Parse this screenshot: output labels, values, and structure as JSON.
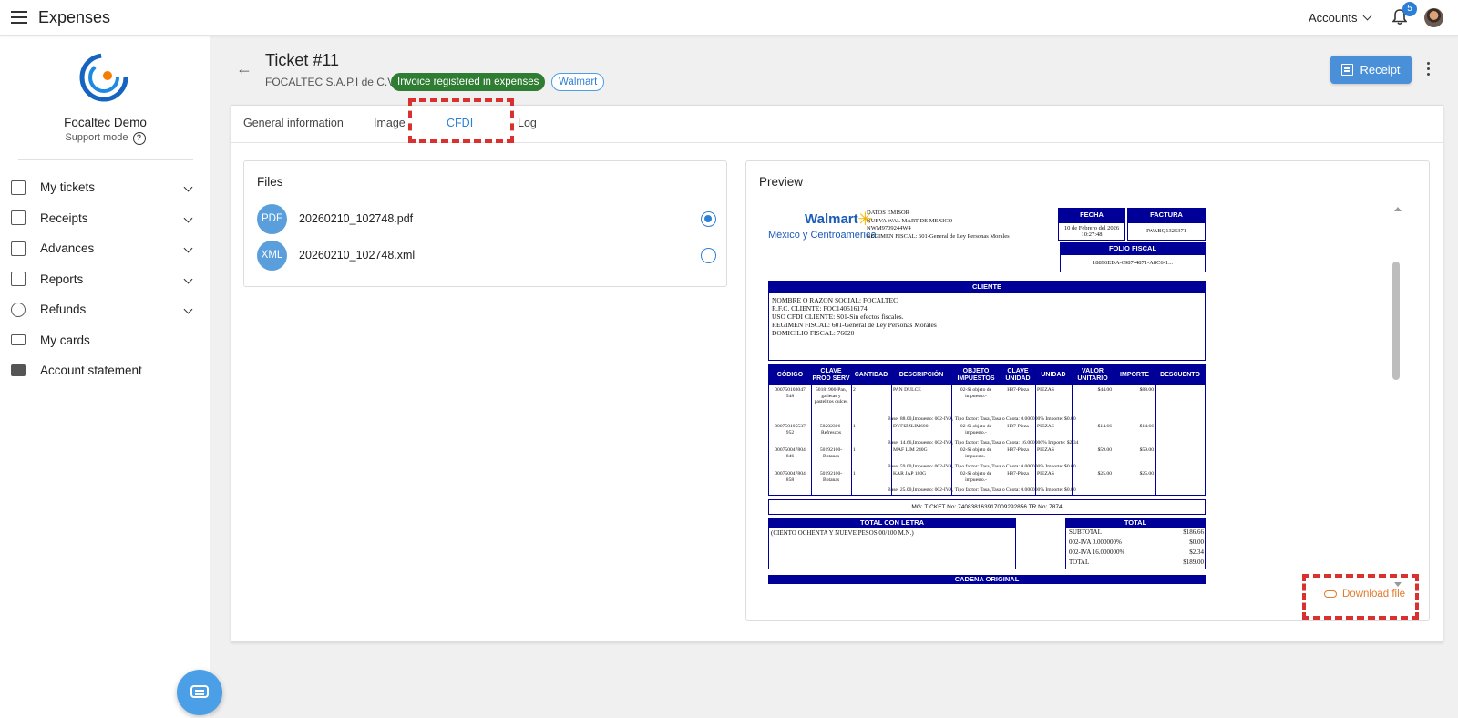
{
  "app": {
    "title": "Expenses"
  },
  "topbar": {
    "accounts_label": "Accounts",
    "notification_count": "5"
  },
  "sidebar": {
    "company": "Focaltec Demo",
    "mode": "Support mode",
    "help_icon": "?",
    "items": [
      {
        "label": "My tickets",
        "icon": "receipt-long-icon",
        "expandable": true
      },
      {
        "label": "Receipts",
        "icon": "document-list-icon",
        "expandable": true
      },
      {
        "label": "Advances",
        "icon": "cash-icon",
        "expandable": true
      },
      {
        "label": "Reports",
        "icon": "report-icon",
        "expandable": true
      },
      {
        "label": "Refunds",
        "icon": "refund-icon",
        "expandable": true
      },
      {
        "label": "My cards",
        "icon": "credit-card-icon",
        "expandable": false
      },
      {
        "label": "Account statement",
        "icon": "wallet-icon",
        "expandable": false
      }
    ]
  },
  "header": {
    "title": "Ticket #11",
    "company": "FOCALTEC S.A.P.I de C.V",
    "status_badge": "Invoice registered in expenses",
    "vendor_badge": "Walmart",
    "receipt_button": "Receipt"
  },
  "tabs": [
    {
      "label": "General information",
      "active": false
    },
    {
      "label": "Image",
      "active": false
    },
    {
      "label": "CFDI",
      "active": true
    },
    {
      "label": "Log",
      "active": false
    }
  ],
  "files": {
    "title": "Files",
    "items": [
      {
        "type": "PDF",
        "name": "20260210_102748.pdf",
        "selected": true
      },
      {
        "type": "XML",
        "name": "20260210_102748.xml",
        "selected": false
      }
    ]
  },
  "preview": {
    "title": "Preview",
    "download_label": "Download file"
  },
  "invoice": {
    "logo_text": "Walmart",
    "logo_sub": "México y Centroamérica",
    "emisor_lines": [
      "DATOS EMISOR",
      "NUEVA WAL MART DE MEXICO",
      "NWM9709244W4",
      "REGIMEN FISCAL: 601-General de Ley Personas Morales"
    ],
    "fecha_label": "FECHA",
    "fecha_value": "10 de Febrero del 2026 10:27:48",
    "factura_label": "FACTURA",
    "factura_value": "IWABQ1325371",
    "folio_label": "FOLIO FISCAL",
    "folio_value": "18896EDA-6987-4871-A8C6-1...",
    "cliente_label": "CLIENTE",
    "cliente_lines": [
      "NOMBRE O RAZON SOCIAL: FOCALTEC",
      "R.F.C. CLIENTE: FOC140516174",
      "USO CFDI CLIENTE: S01-Sin efectos fiscales.",
      "REGIMEN FISCAL: 601-General de Ley Personas Morales",
      "DOMICILIO FISCAL: 76020"
    ],
    "table_headers": [
      "CÓDIGO",
      "CLAVE PROD SERV",
      "CANTIDAD",
      "DESCRIPCIÓN",
      "OBJETO IMPUESTOS",
      "CLAVE UNIDAD",
      "UNIDAD",
      "VALOR UNITARIO",
      "IMPORTE",
      "DESCUENTO"
    ],
    "rows": [
      {
        "codigo": "000750103047 548",
        "clave": "50181900-Pan, galletas y pastelitos dulces",
        "cantidad": "2",
        "desc": "PAN DULCE",
        "objeto": "02-Si objeto de impuesto.-",
        "cunidad": "H87-Pieza",
        "unidad": "PIEZAS",
        "valor": "$44.00",
        "importe": "$88.00",
        "tax": "Base: 88.00,Impuesto: 002-IVA, Tipo factor: Tasa, Tasa o Cuota: 0.000000% Importe: $0.00"
      },
      {
        "codigo": "000750105537 952",
        "clave": "50202306-Refrescos",
        "cantidad": "1",
        "desc": "DYFIZZLIM600",
        "objeto": "02-Si objeto de impuesto.-",
        "cunidad": "H87-Pieza",
        "unidad": "PIEZAS",
        "valor": "$14.66",
        "importe": "$14.66",
        "tax": "Base: 14.66,Impuesto: 002-IVA, Tipo factor: Tasa, Tasa o Cuota: 16.000000% Importe: $2.34"
      },
      {
        "codigo": "000750047804 846",
        "clave": "50192100-Botanas",
        "cantidad": "1",
        "desc": "MAF LIM 240G",
        "objeto": "02-Si objeto de impuesto.-",
        "cunidad": "H87-Pieza",
        "unidad": "PIEZAS",
        "valor": "$59.00",
        "importe": "$59.00",
        "tax": "Base: 59.00,Impuesto: 002-IVA, Tipo factor: Tasa, Tasa o Cuota: 0.000000% Importe: $0.00"
      },
      {
        "codigo": "000750047804 858",
        "clave": "50192100-Botanas",
        "cantidad": "1",
        "desc": "KAR JAP 180G",
        "objeto": "02-Si objeto de impuesto.-",
        "cunidad": "H87-Pieza",
        "unidad": "PIEZAS",
        "valor": "$25.00",
        "importe": "$25.00",
        "tax": "Base: 25.00,Impuesto: 002-IVA, Tipo factor: Tasa, Tasa o Cuota: 0.000000% Importe: $0.00"
      }
    ],
    "ticket_line": "MG: TICKET No: 740838163917009292856 TR No: 7874",
    "total_letra_label": "TOTAL CON LETRA",
    "total_letra_value": "(CIENTO OCHENTA Y NUEVE PESOS 00/100 M.N.)",
    "total_label": "TOTAL",
    "totals": [
      {
        "label": "SUBTOTAL",
        "value": "$186.66"
      },
      {
        "label": "002-IVA 0.000000%",
        "value": "$0.00"
      },
      {
        "label": "002-IVA 16.000000%",
        "value": "$2.34"
      },
      {
        "label": "TOTAL",
        "value": "$189.00"
      }
    ],
    "cadena_label": "CADENA ORIGINAL"
  }
}
